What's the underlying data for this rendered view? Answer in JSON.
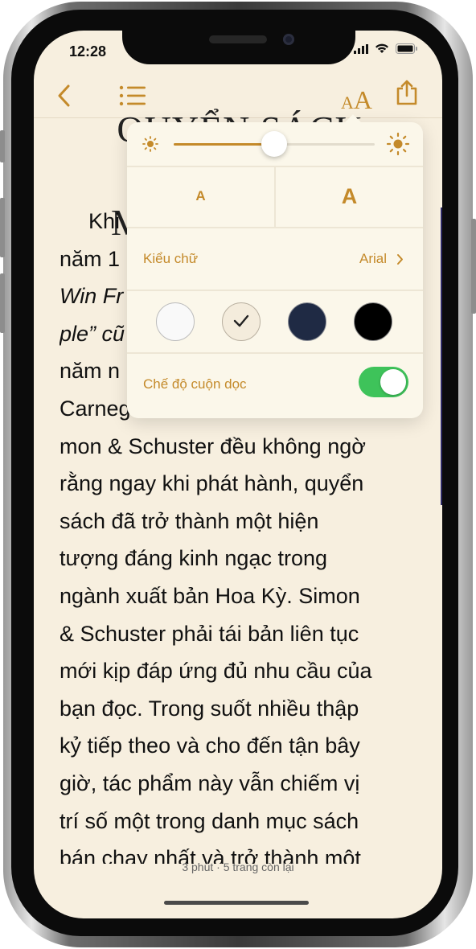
{
  "status_bar": {
    "time": "12:28"
  },
  "toolbar": {
    "back_icon": "chevron-left-icon",
    "toc_icon": "list-icon",
    "text_settings_icon": "aa-icon",
    "share_icon": "share-icon",
    "aa_small": "A",
    "aa_big": "A"
  },
  "chapter": {
    "title_line1": "QUYỂN SÁCH CỦA",
    "title_line2": "M"
  },
  "body_lines": [
    "Khi",
    "năm 1",
    "Win Fr",
    "ple” cũ",
    "năm n",
    "Carneg",
    "mon & Schuster đều không ngờ",
    "rằng ngay khi phát hành, quyển",
    "sách đã trở thành một hiện",
    "tượng đáng kinh ngạc trong",
    "ngành xuất bản Hoa Kỳ. Simon",
    "& Schuster phải tái bản liên tục",
    "mới kịp đáp ứng đủ nhu cầu của",
    "bạn đọc. Trong suốt nhiều thập",
    "kỷ tiếp theo và cho đến tận bây",
    "giờ, tác phẩm này vẫn chiếm vị",
    "trí số một trong danh mục sách",
    "bán chạy nhất và trở thành một"
  ],
  "footer": {
    "progress": "3 phút · 5 trang còn lại"
  },
  "popover": {
    "brightness": {
      "level": 0.5
    },
    "font_size_small_label": "A",
    "font_size_large_label": "A",
    "font_label": "Kiểu chữ",
    "font_value": "Arial",
    "themes": [
      {
        "name": "white",
        "color": "#f9f9f9",
        "selected": false
      },
      {
        "name": "sepia",
        "color": "#f4ecdc",
        "selected": true
      },
      {
        "name": "navy",
        "color": "#1f2a44",
        "selected": false
      },
      {
        "name": "black",
        "color": "#000000",
        "selected": false
      }
    ],
    "scroll_label": "Chế độ cuộn dọc",
    "scroll_enabled": true
  },
  "colors": {
    "accent": "#c48a2a",
    "page_bg": "#f7efdf",
    "toggle_on": "#3ec35a"
  }
}
